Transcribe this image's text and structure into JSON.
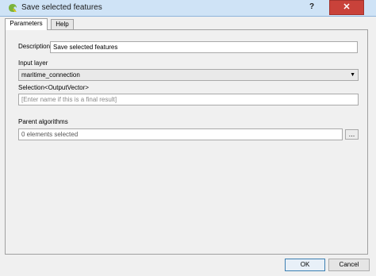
{
  "window": {
    "title": "Save selected features",
    "help_glyph": "?",
    "close_glyph": "✕"
  },
  "tabs": [
    {
      "label": "Parameters",
      "active": true
    },
    {
      "label": "Help",
      "active": false
    }
  ],
  "form": {
    "description_label": "Description",
    "description_value": "Save selected features",
    "input_layer_label": "Input layer",
    "input_layer_value": "maritime_connection",
    "selection_label": "Selection<OutputVector>",
    "selection_placeholder": "[Enter name if this is a final result]",
    "parent_algorithms_label": "Parent algorithms",
    "parent_algorithms_value": "0 elements selected",
    "browse_label": "..."
  },
  "buttons": {
    "ok": "OK",
    "cancel": "Cancel"
  },
  "colors": {
    "titlebar": "#cfe3f6",
    "close": "#c9423a",
    "dialog_bg": "#f0f0f0"
  }
}
